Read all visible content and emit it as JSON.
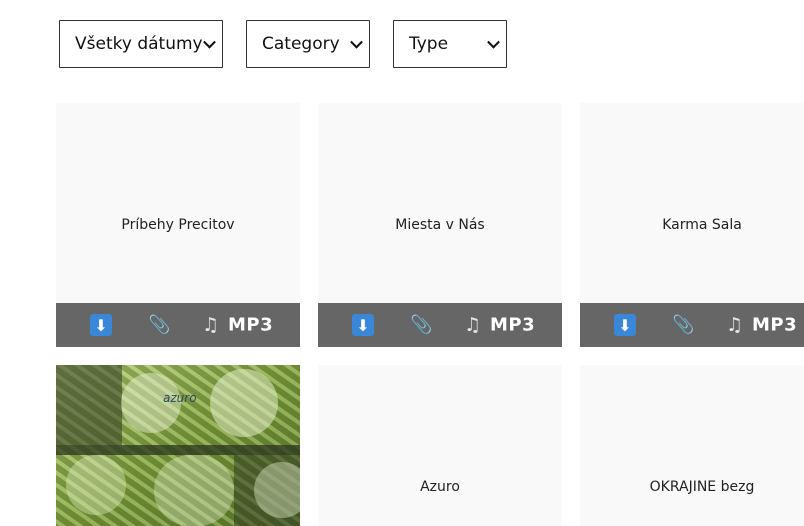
{
  "filters": {
    "dates": "Všetky dátumy",
    "category": "Category",
    "type": "Type"
  },
  "cards": [
    {
      "title": "Príbehy Precitov",
      "mp3_label": "MP3"
    },
    {
      "title": "Miesta v Nás",
      "mp3_label": "MP3"
    },
    {
      "title": "Karma Sala",
      "mp3_label": "MP3"
    },
    {
      "logo_text": "azuro"
    },
    {
      "title": "Azuro"
    },
    {
      "title": "OKRAJINE bezg"
    }
  ],
  "icons": {
    "download": "download-icon",
    "attachment": "paperclip-icon",
    "audio": "music-note-icon"
  },
  "colors": {
    "card_bg": "#f9f9f9",
    "action_bar": "#666666",
    "download_icon_bg": "#3a86d8"
  }
}
